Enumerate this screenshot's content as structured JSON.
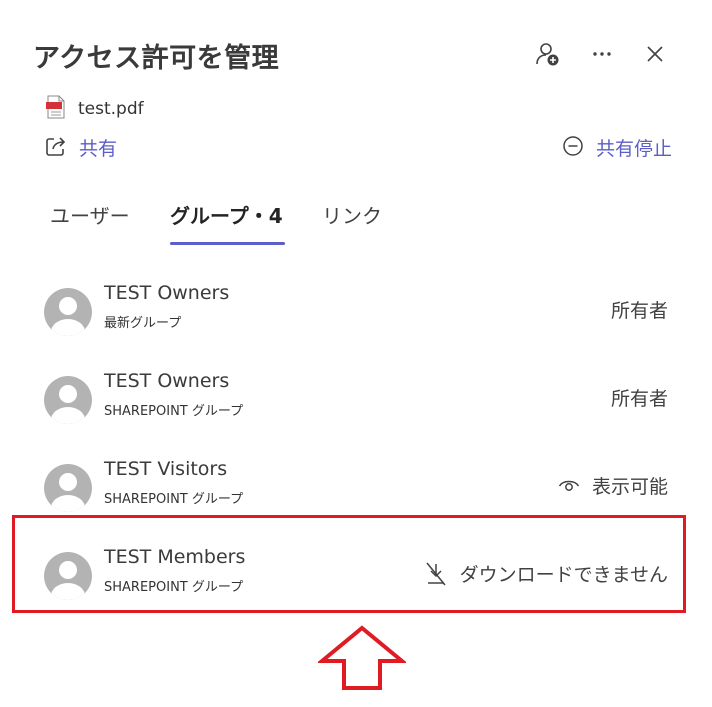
{
  "header": {
    "title": "アクセス許可を管理"
  },
  "file": {
    "name": "test.pdf"
  },
  "actions": {
    "share_label": "共有",
    "stop_share_label": "共有停止"
  },
  "tabs": [
    {
      "label": "ユーザー",
      "active": false
    },
    {
      "label": "グループ・4",
      "active": true
    },
    {
      "label": "リンク",
      "active": false
    }
  ],
  "groups": [
    {
      "name": "TEST Owners",
      "type": "最新グループ",
      "permission": "所有者",
      "icon": ""
    },
    {
      "name": "TEST Owners",
      "type": "SHAREPOINT グループ",
      "permission": "所有者",
      "icon": ""
    },
    {
      "name": "TEST Visitors",
      "type": "SHAREPOINT グループ",
      "permission": "表示可能",
      "icon": "eye-icon"
    },
    {
      "name": "TEST Members",
      "type": "SHAREPOINT グループ",
      "permission": "ダウンロードできません",
      "icon": "no-download-icon"
    }
  ],
  "colors": {
    "accent": "#5b5fc7",
    "highlight": "#e01b24",
    "avatar": "#b3b3b3"
  }
}
